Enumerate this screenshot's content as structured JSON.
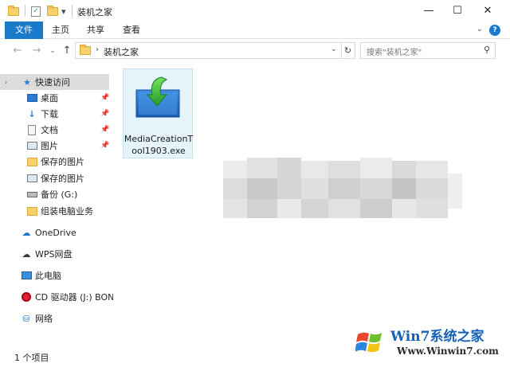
{
  "titlebar": {
    "title": "装机之家",
    "qa_dropdown_icon": "▾",
    "minimize_icon": "—",
    "maximize_icon": "☐",
    "close_icon": "✕"
  },
  "ribbon": {
    "tabs": [
      {
        "label": "文件"
      },
      {
        "label": "主页"
      },
      {
        "label": "共享"
      },
      {
        "label": "查看"
      }
    ],
    "expand_icon": "⌄",
    "help_icon": "?"
  },
  "address": {
    "path": "装机之家",
    "crumb_arrow": "›",
    "search_placeholder": "搜索\"装机之家\"",
    "refresh_icon": "↻",
    "dropdown_icon": "⌄",
    "search_icon": "⚲"
  },
  "navpane": {
    "items": [
      {
        "label": "快速访问",
        "icon": "star-icon"
      },
      {
        "label": "桌面",
        "icon": "desktop-icon",
        "pinned": true
      },
      {
        "label": "下载",
        "icon": "download-icon",
        "pinned": true
      },
      {
        "label": "文档",
        "icon": "document-icon",
        "pinned": true
      },
      {
        "label": "图片",
        "icon": "picture-icon",
        "pinned": true
      },
      {
        "label": "保存的图片",
        "icon": "folder-icon"
      },
      {
        "label": "保存的图片",
        "icon": "picture-icon"
      },
      {
        "label": "备份 (G:)",
        "icon": "drive-icon"
      },
      {
        "label": "组装电脑业务",
        "icon": "folder-icon"
      },
      {
        "label": "OneDrive",
        "icon": "cloud-icon"
      },
      {
        "label": "WPS网盘",
        "icon": "wps-cloud-icon"
      },
      {
        "label": "此电脑",
        "icon": "computer-icon"
      },
      {
        "label": "CD 驱动器 (J:) BON.",
        "icon": "cd-drive-icon"
      },
      {
        "label": "网络",
        "icon": "network-icon"
      }
    ]
  },
  "content": {
    "file": {
      "name": "MediaCreationTool1903.exe",
      "icon": "media-creation-tool-icon"
    }
  },
  "status": {
    "item_count": "1 个项目"
  },
  "watermark": {
    "title": "Win7系统之家",
    "url": "Www.Winwin7.com"
  },
  "colors": {
    "accent": "#1979ca",
    "selection": "#dcdcdc",
    "file_tile": "#e5f3fb",
    "folder": "#f7d26a"
  }
}
